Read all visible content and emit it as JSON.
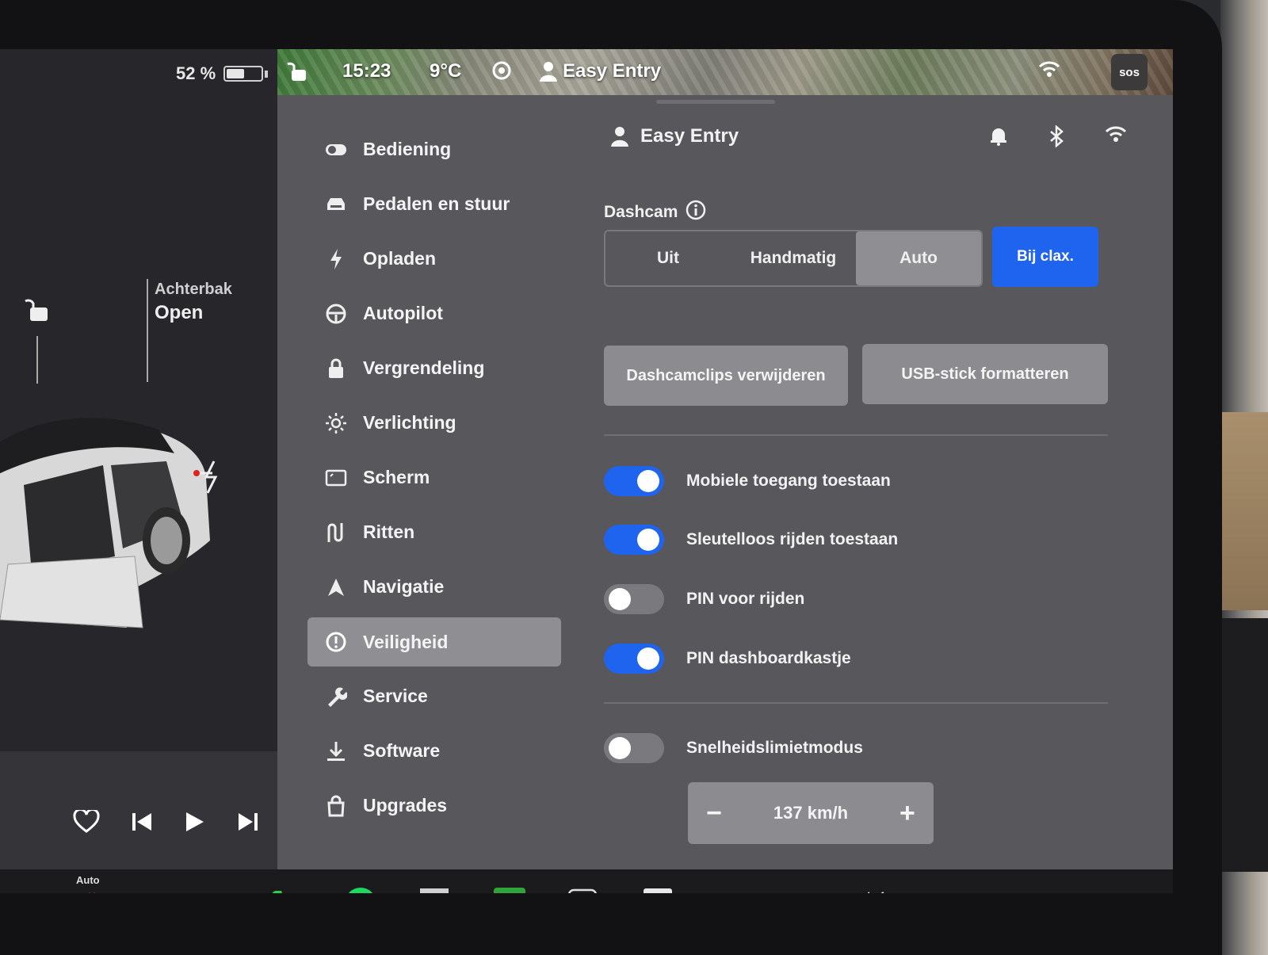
{
  "status_bar": {
    "time": "15:23",
    "temperature": "9°C",
    "profile": "Easy Entry",
    "sos": "sos",
    "icons": [
      "unlock-icon",
      "sentry-icon",
      "person-icon",
      "wifi-icon"
    ]
  },
  "car": {
    "battery_percent": "52 %",
    "battery_level": 0.52,
    "trunk_label": "Achterbak",
    "trunk_status": "Open"
  },
  "nav": {
    "items": [
      {
        "label": "Bediening",
        "icon": "toggle-icon"
      },
      {
        "label": "Pedalen en stuur",
        "icon": "car-icon"
      },
      {
        "label": "Opladen",
        "icon": "bolt-icon"
      },
      {
        "label": "Autopilot",
        "icon": "steering-wheel-icon"
      },
      {
        "label": "Vergrendeling",
        "icon": "lock-icon"
      },
      {
        "label": "Verlichting",
        "icon": "sun-icon"
      },
      {
        "label": "Scherm",
        "icon": "display-icon"
      },
      {
        "label": "Ritten",
        "icon": "trips-icon"
      },
      {
        "label": "Navigatie",
        "icon": "navigation-arrow-icon"
      },
      {
        "label": "Veiligheid",
        "icon": "alert-circle-icon",
        "active": true
      },
      {
        "label": "Service",
        "icon": "wrench-icon"
      },
      {
        "label": "Software",
        "icon": "download-icon"
      },
      {
        "label": "Upgrades",
        "icon": "shopping-bag-icon"
      }
    ]
  },
  "header": {
    "profile_name": "Easy Entry",
    "icons": [
      "bell-icon",
      "bluetooth-icon",
      "wifi-icon"
    ]
  },
  "dashcam": {
    "label": "Dashcam",
    "options": [
      "Uit",
      "Handmatig",
      "Auto"
    ],
    "selected": "Auto",
    "horn_option": "Bij clax.",
    "delete_clips": "Dashcamclips verwijderen",
    "format_usb": "USB-stick formatteren"
  },
  "toggles": [
    {
      "label": "Mobiele toegang toestaan",
      "on": true
    },
    {
      "label": "Sleutelloos rijden toestaan",
      "on": true
    },
    {
      "label": "PIN voor rijden",
      "on": false
    },
    {
      "label": "PIN dashboardkastje",
      "on": true
    }
  ],
  "speed_limit": {
    "label": "Snelheidslimietmodus",
    "on": false,
    "value": "137",
    "unit": "km/h",
    "minus": "−",
    "plus": "+"
  },
  "dock": {
    "auto_label": "Auto",
    "items": [
      "seat-heater-icon",
      "wiper-icon",
      "phone-icon",
      "spotify-icon",
      "calendar-icon",
      "energy-app-icon",
      "more-apps-icon",
      "theater-icon",
      "volume-icon"
    ]
  },
  "colors": {
    "accent_blue": "#1e64ee",
    "panel": "#58585c",
    "active_item": "#8f8f93"
  }
}
